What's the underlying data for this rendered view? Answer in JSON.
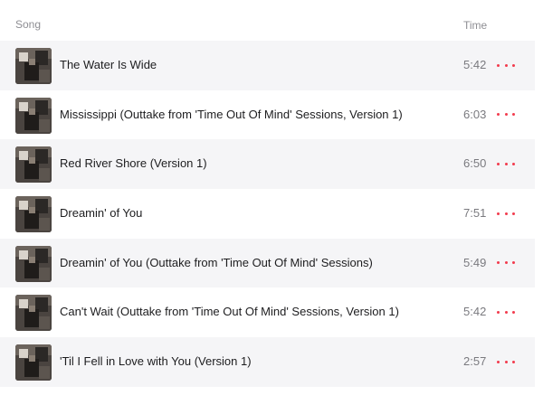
{
  "header": {
    "song_label": "Song",
    "time_label": "Time"
  },
  "tracks": [
    {
      "title": "The Water Is Wide",
      "time": "5:42"
    },
    {
      "title": "Mississippi (Outtake from 'Time Out Of Mind' Sessions, Version 1)",
      "time": "6:03"
    },
    {
      "title": "Red River Shore (Version 1)",
      "time": "6:50"
    },
    {
      "title": "Dreamin' of You",
      "time": "7:51"
    },
    {
      "title": "Dreamin' of You (Outtake from 'Time Out Of Mind' Sessions)",
      "time": "5:49"
    },
    {
      "title": "Can't Wait (Outtake from 'Time Out Of Mind' Sessions, Version 1)",
      "time": "5:42"
    },
    {
      "title": "'Til I Fell in Love with You (Version 1)",
      "time": "2:57"
    }
  ],
  "colors": {
    "accent": "#f23b4d",
    "row_alt": "#f5f5f7"
  },
  "icons": {
    "more": "ellipsis-more-icon",
    "artwork": "album-artwork"
  }
}
